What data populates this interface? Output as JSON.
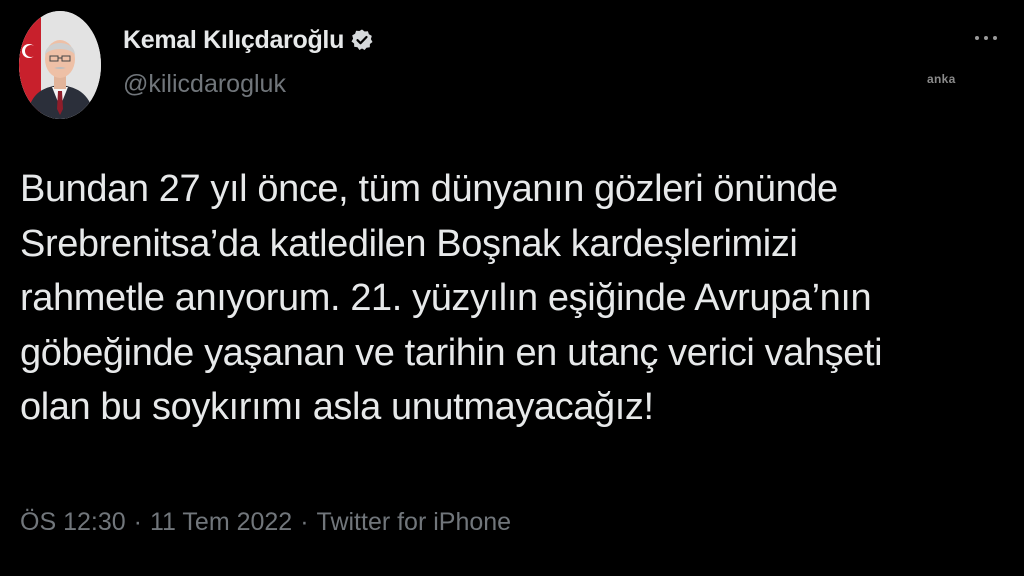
{
  "author": {
    "display_name": "Kemal Kılıçdaroğlu",
    "handle": "@kilicdarogluk",
    "verified": true,
    "avatar_icon": "profile-photo"
  },
  "watermark": "anka",
  "tweet": {
    "lines": [
      "Bundan 27 yıl önce, tüm dünyanın gözleri önünde",
      "Srebrenitsa’da katledilen Boşnak kardeşlerimizi",
      "rahmetle anıyorum. 21. yüzyılın eşiğinde Avrupa’nın",
      "göbeğinde yaşanan ve tarihin en utanç verici vahşeti",
      "olan bu soykırımı asla unutmayacağız!"
    ]
  },
  "meta": {
    "time": "ÖS 12:30",
    "separator": "·",
    "date": "11 Tem 2022",
    "source": "Twitter for iPhone"
  },
  "colors": {
    "background": "#000000",
    "primary_text": "#e7e9ea",
    "secondary_text": "#71767b"
  }
}
